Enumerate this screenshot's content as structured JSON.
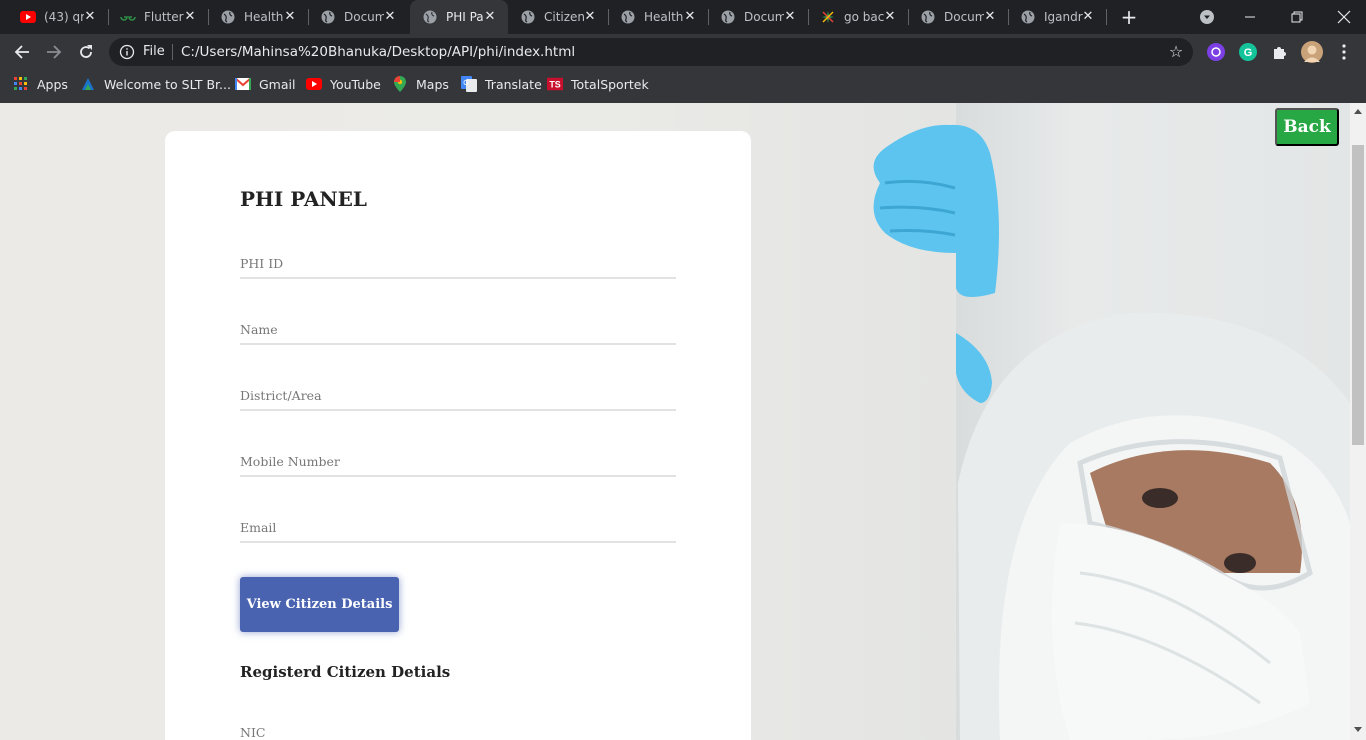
{
  "browser": {
    "tabs": [
      {
        "title": "(43) qr",
        "icon": "youtube-icon"
      },
      {
        "title": "Flutter",
        "icon": "geeksforgeeks-icon"
      },
      {
        "title": "Health",
        "icon": "globe-icon"
      },
      {
        "title": "Docum",
        "icon": "globe-icon"
      },
      {
        "title": "PHI Pa",
        "icon": "globe-icon",
        "active": true
      },
      {
        "title": "Citizen",
        "icon": "globe-icon"
      },
      {
        "title": "Health",
        "icon": "globe-icon"
      },
      {
        "title": "Docum",
        "icon": "globe-icon"
      },
      {
        "title": "go bac",
        "icon": "star-burst-icon"
      },
      {
        "title": "Docum",
        "icon": "globe-icon"
      },
      {
        "title": "Igandr",
        "icon": "globe-icon"
      }
    ],
    "address": {
      "scheme_label": "File",
      "url": "C:/Users/Mahinsa%20Bhanuka/Desktop/API/phi/index.html"
    },
    "bookmarks": [
      {
        "label": "Apps",
        "icon": "apps-grid-icon"
      },
      {
        "label": "Welcome to SLT Br...",
        "icon": "slt-icon"
      },
      {
        "label": "Gmail",
        "icon": "gmail-icon"
      },
      {
        "label": "YouTube",
        "icon": "youtube-icon"
      },
      {
        "label": "Maps",
        "icon": "maps-pin-icon"
      },
      {
        "label": "Translate",
        "icon": "translate-icon"
      },
      {
        "label": "TotalSportek",
        "icon": "ts-icon"
      }
    ]
  },
  "page": {
    "back_label": "Back",
    "panel_title": "PHI PANEL",
    "fields": [
      {
        "placeholder": "PHI ID"
      },
      {
        "placeholder": "Name"
      },
      {
        "placeholder": "District/Area"
      },
      {
        "placeholder": "Mobile Number"
      },
      {
        "placeholder": "Email"
      }
    ],
    "view_button_label": "View Citizen Details",
    "registered_title": "Registerd Citizen Detials",
    "nic_label": "NIC"
  },
  "colors": {
    "back_button": "#28a745",
    "view_button": "#4a63b0",
    "tab_strip": "#202124",
    "toolbar": "#35363a"
  }
}
